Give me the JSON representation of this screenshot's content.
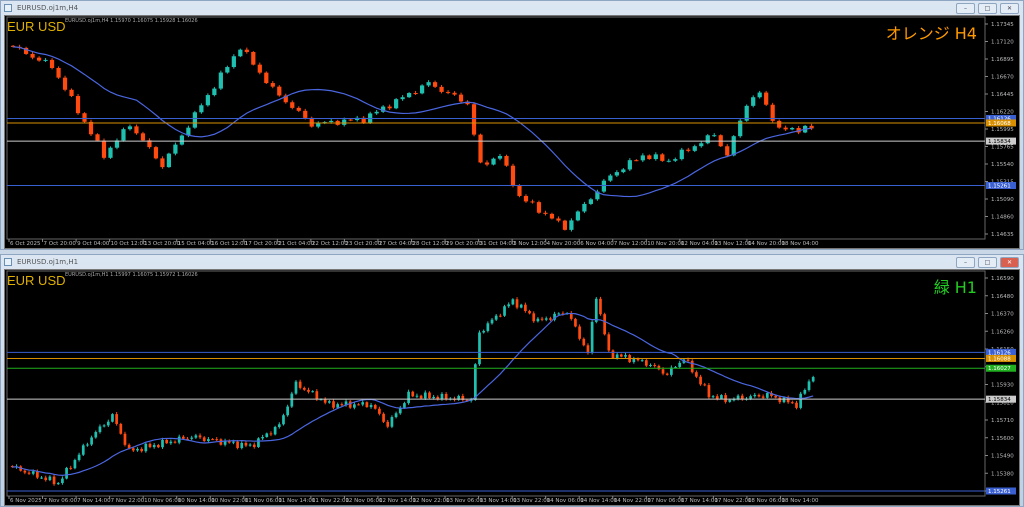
{
  "windows": [
    {
      "title": "EURUSD.oj1m,H4",
      "symbol_label": "EUR USD",
      "ohlc": "EURUSD.oj1m,H4  1.15970 1.16075 1.15928 1.16026",
      "timeframe_label": "オレンジ H4",
      "timeframe_color": "#ff9900",
      "buttons": {
        "minimize": "–",
        "maximize": "□",
        "close": "✕"
      },
      "price_axis": [
        "1.17345",
        "1.17120",
        "1.16895",
        "1.16670",
        "1.16445",
        "1.16220",
        "1.15995",
        "1.15765",
        "1.15540",
        "1.15315",
        "1.15090",
        "1.14860",
        "1.14635"
      ],
      "time_axis": [
        "6 Oct 2025",
        "7 Oct 20:00",
        "9 Oct 04:00",
        "10 Oct 12:00",
        "13 Oct 20:00",
        "15 Oct 04:00",
        "16 Oct 12:00",
        "17 Oct 20:00",
        "21 Oct 04:00",
        "22 Oct 12:00",
        "23 Oct 20:00",
        "27 Oct 04:00",
        "28 Oct 12:00",
        "29 Oct 20:00",
        "31 Oct 04:00",
        "3 Nov 12:00",
        "4 Nov 20:00",
        "6 Nov 04:00",
        "7 Nov 12:00",
        "10 Nov 20:00",
        "12 Nov 04:00",
        "13 Nov 12:00",
        "14 Nov 20:00",
        "18 Nov 04:00"
      ],
      "lines": [
        {
          "price": 1.16126,
          "label": "1.16126",
          "color": "#3a5fd0"
        },
        {
          "price": 1.16068,
          "label": "1.16068",
          "color": "#d89000"
        },
        {
          "price": 1.15834,
          "label": "1.15834",
          "color": "#cccccc"
        },
        {
          "price": 1.15261,
          "label": "1.15261",
          "color": "#3a5fd0"
        }
      ]
    },
    {
      "title": "EURUSD.oj1m,H1",
      "symbol_label": "EUR USD",
      "ohlc": "EURUSD.oj1m,H1  1.15997 1.16075 1.15972 1.16026",
      "timeframe_label": "緑 H1",
      "timeframe_color": "#22cc22",
      "buttons": {
        "minimize": "–",
        "maximize": "□",
        "close": "✕"
      },
      "price_axis": [
        "1.16590",
        "1.16480",
        "1.16370",
        "1.16260",
        "1.16150",
        "1.16040",
        "1.15930",
        "1.15820",
        "1.15710",
        "1.15600",
        "1.15490",
        "1.15380",
        "1.15270"
      ],
      "time_axis": [
        "6 Nov 2025",
        "7 Nov 06:00",
        "7 Nov 14:00",
        "7 Nov 22:00",
        "10 Nov 06:00",
        "10 Nov 14:00",
        "10 Nov 22:00",
        "11 Nov 06:00",
        "11 Nov 14:00",
        "11 Nov 22:00",
        "12 Nov 06:00",
        "12 Nov 14:00",
        "12 Nov 22:00",
        "13 Nov 06:00",
        "13 Nov 14:00",
        "13 Nov 22:00",
        "14 Nov 06:00",
        "14 Nov 14:00",
        "14 Nov 22:00",
        "17 Nov 06:00",
        "17 Nov 14:00",
        "17 Nov 22:00",
        "18 Nov 06:00",
        "18 Nov 14:00"
      ],
      "lines": [
        {
          "price": 1.16126,
          "label": "1.16126",
          "color": "#3a5fd0"
        },
        {
          "price": 1.16088,
          "label": "1.16088",
          "color": "#d89000"
        },
        {
          "price": 1.16027,
          "label": "1.16027",
          "color": "#20b020"
        },
        {
          "price": 1.15834,
          "label": "1.15834",
          "color": "#cccccc"
        },
        {
          "price": 1.15261,
          "label": "1.15261",
          "color": "#3a5fd0"
        }
      ]
    }
  ],
  "chart_data": [
    {
      "type": "candlestick",
      "title": "EURUSD.oj1m,H4",
      "ylim": [
        1.14635,
        1.17345
      ],
      "bull_color": "#20c0b0",
      "bear_color": "#ff4a10",
      "ma_color": "#4a66e0",
      "ma_period": 20,
      "candle_count": 124,
      "close_keypoints": [
        [
          0,
          1.1705
        ],
        [
          6,
          1.168
        ],
        [
          14,
          1.1565
        ],
        [
          18,
          1.1605
        ],
        [
          23,
          1.1552
        ],
        [
          29,
          1.163
        ],
        [
          35,
          1.1705
        ],
        [
          40,
          1.165
        ],
        [
          46,
          1.1605
        ],
        [
          54,
          1.1612
        ],
        [
          64,
          1.1658
        ],
        [
          70,
          1.1632
        ],
        [
          72,
          1.1552
        ],
        [
          75,
          1.1565
        ],
        [
          78,
          1.1512
        ],
        [
          85,
          1.1472
        ],
        [
          92,
          1.1539
        ],
        [
          97,
          1.1565
        ],
        [
          101,
          1.1558
        ],
        [
          108,
          1.1592
        ],
        [
          110,
          1.1565
        ],
        [
          113,
          1.1632
        ],
        [
          115,
          1.1645
        ],
        [
          118,
          1.1598
        ],
        [
          123,
          1.16
        ]
      ]
    },
    {
      "type": "candlestick",
      "title": "EURUSD.oj1m,H1",
      "ylim": [
        1.15261,
        1.1659
      ],
      "bull_color": "#20c0b0",
      "bear_color": "#ff4a10",
      "ma_color": "#4a66e0",
      "ma_period": 20,
      "candle_count": 193,
      "close_keypoints": [
        [
          0,
          1.1541
        ],
        [
          11,
          1.1531
        ],
        [
          19,
          1.156
        ],
        [
          24,
          1.1573
        ],
        [
          28,
          1.1551
        ],
        [
          43,
          1.156
        ],
        [
          57,
          1.1554
        ],
        [
          64,
          1.1567
        ],
        [
          68,
          1.1593
        ],
        [
          76,
          1.158
        ],
        [
          86,
          1.158
        ],
        [
          90,
          1.1567
        ],
        [
          95,
          1.1586
        ],
        [
          110,
          1.1583
        ],
        [
          112,
          1.1625
        ],
        [
          120,
          1.1645
        ],
        [
          126,
          1.1632
        ],
        [
          133,
          1.1638
        ],
        [
          138,
          1.1612
        ],
        [
          140,
          1.1648
        ],
        [
          143,
          1.1612
        ],
        [
          152,
          1.1606
        ],
        [
          157,
          1.1599
        ],
        [
          161,
          1.1609
        ],
        [
          167,
          1.1586
        ],
        [
          171,
          1.1583
        ],
        [
          181,
          1.1586
        ],
        [
          188,
          1.158
        ],
        [
          192,
          1.1599
        ]
      ]
    }
  ]
}
